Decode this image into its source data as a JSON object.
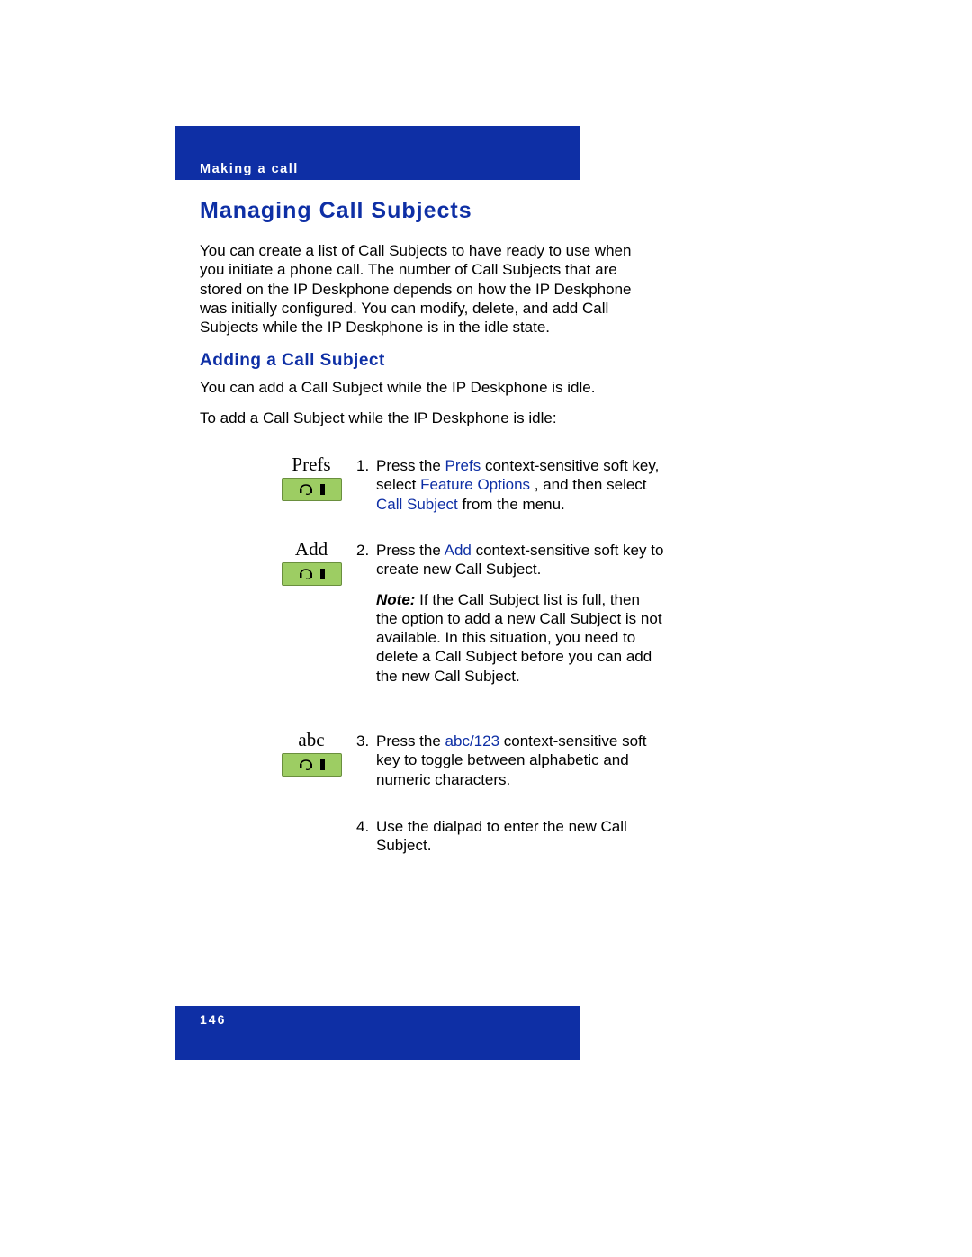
{
  "header": "Making a call",
  "heading": "Managing Call Subjects",
  "intro": "You can create a list of Call Subjects to have ready to use when you initiate a phone call. The number of Call Subjects that are stored on the IP Deskphone depends on how the IP Deskphone was initially configured. You can modify, delete, and add Call Subjects while the IP Deskphone is in the idle state.",
  "subheading": "Adding a Call Subject",
  "subpara1": "You can add a Call Subject while the IP Deskphone is idle.",
  "subpara2": "To add a Call Subject while the IP Deskphone is idle:",
  "softkeys": {
    "prefs": "Prefs",
    "add": "Add",
    "abc": "abc"
  },
  "steps": {
    "s1": {
      "num": "1.",
      "pre": "Press the ",
      "link1": "Prefs",
      "mid1": " context-sensitive soft key, select ",
      "link2": "Feature Options",
      "mid2": " , and then select ",
      "link3": "Call Subject",
      "post": "  from the menu."
    },
    "s2": {
      "num": "2.",
      "pre": "Press the ",
      "link1": "Add",
      "post": " context-sensitive soft key to create new Call Subject.",
      "noteLabel": "Note:",
      "noteText": "  If the Call Subject list is full, then the option to add a new Call Subject is not available. In this situation, you need to delete a Call Subject before you can add the new Call Subject."
    },
    "s3": {
      "num": "3.",
      "pre": "Press the ",
      "link1": "abc/123",
      "post": " context-sensitive soft key to toggle between alphabetic and numeric characters."
    },
    "s4": {
      "num": "4.",
      "text": "Use the dialpad to enter the new Call Subject."
    }
  },
  "pageNumber": "146"
}
